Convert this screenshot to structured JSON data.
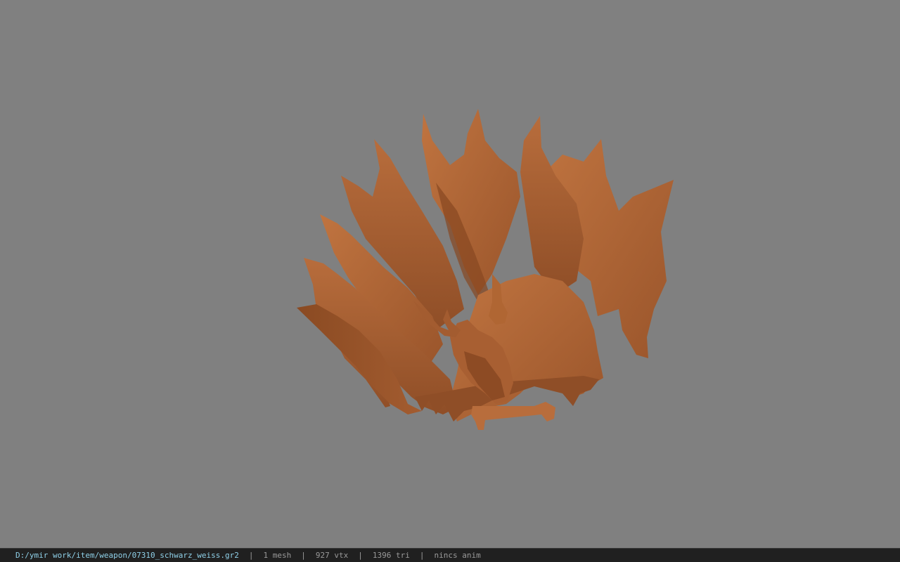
{
  "viewport": {
    "background": "#808080",
    "model_color": "#b56a3a",
    "model_subject": "nine-tailed fox weapon mesh"
  },
  "statusbar": {
    "path": "D:/ymir work/item/weapon/07310_schwarz_weiss.gr2",
    "separator": "|",
    "mesh": "1 mesh",
    "vertices": "927 vtx",
    "triangles": "1396 tri",
    "anim": "nincs anim",
    "path_color": "#8fd0e8",
    "info_color": "#9a9a9a"
  }
}
